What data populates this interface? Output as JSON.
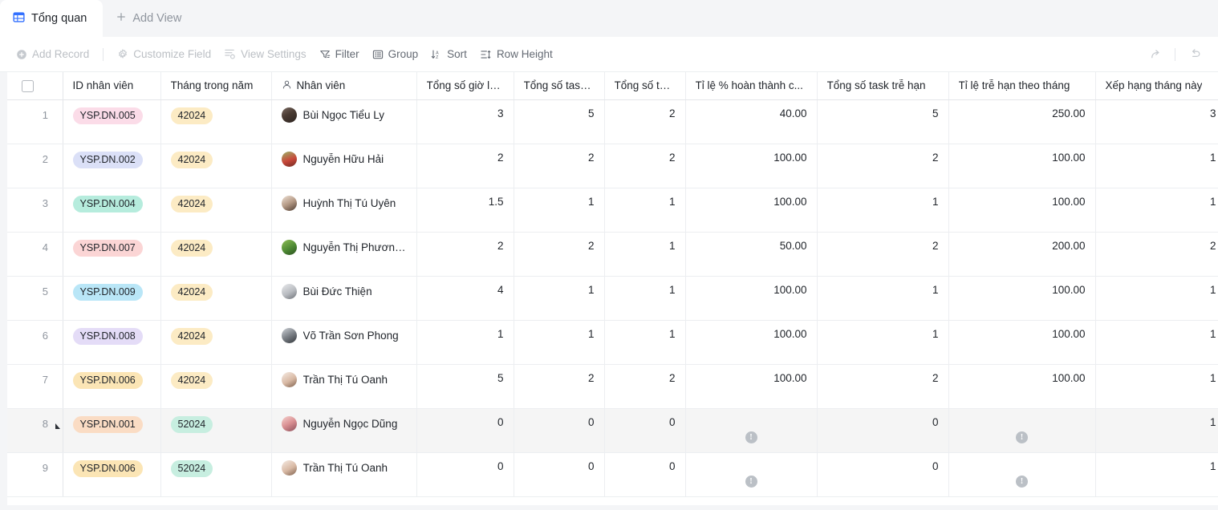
{
  "tabs": [
    {
      "label": "Tổng quan",
      "icon": "grid-icon",
      "active": true
    },
    {
      "label": "Add View",
      "icon": "plus-icon",
      "active": false
    }
  ],
  "toolbar": {
    "add_record": "Add Record",
    "customize_field": "Customize Field",
    "view_settings": "View Settings",
    "filter": "Filter",
    "group": "Group",
    "sort": "Sort",
    "row_height": "Row Height",
    "share_icon": "share-icon",
    "undo_icon": "undo-icon"
  },
  "grid": {
    "columns": [
      {
        "key": "chk",
        "label": "",
        "icon": "checkbox-icon",
        "align": "center"
      },
      {
        "key": "id",
        "label": "ID nhân viên",
        "align": "left"
      },
      {
        "key": "month",
        "label": "Tháng trong năm",
        "align": "left"
      },
      {
        "key": "emp",
        "label": "Nhân viên",
        "icon": "person-icon",
        "align": "left"
      },
      {
        "key": "hours",
        "label": "Tổng số giờ là...",
        "align": "right"
      },
      {
        "key": "t1",
        "label": "Tổng số task ...",
        "align": "right"
      },
      {
        "key": "t2",
        "label": "Tổng số tas...",
        "align": "right"
      },
      {
        "key": "pct",
        "label": "Tỉ lệ % hoàn thành c...",
        "align": "right"
      },
      {
        "key": "late",
        "label": "Tổng số task trễ hạn",
        "align": "right"
      },
      {
        "key": "ratio",
        "label": "Tỉ lệ trễ hạn theo tháng",
        "align": "right"
      },
      {
        "key": "rank",
        "label": "Xếp hạng tháng này",
        "align": "right"
      }
    ],
    "rows": [
      {
        "n": "1",
        "id": "YSP.DN.005",
        "id_color": "#fbdce8",
        "month": "42024",
        "month_color": "#fcebc4",
        "emp": "Bùi Ngọc Tiểu Ly",
        "avatar": "photo-female-dark",
        "hours": "3",
        "t1": "5",
        "t2": "2",
        "pct": "40.00",
        "late": "5",
        "ratio": "250.00",
        "rank": "3",
        "highlight": false,
        "expand": false
      },
      {
        "n": "2",
        "id": "YSP.DN.002",
        "id_color": "#dbe0f7",
        "month": "42024",
        "month_color": "#fcebc4",
        "emp": "Nguyễn Hữu Hải",
        "avatar": "photo-red-outdoor",
        "hours": "2",
        "t1": "2",
        "t2": "2",
        "pct": "100.00",
        "late": "2",
        "ratio": "100.00",
        "rank": "1",
        "highlight": false,
        "expand": false
      },
      {
        "n": "3",
        "id": "YSP.DN.004",
        "id_color": "#b6ecdd",
        "month": "42024",
        "month_color": "#fcebc4",
        "emp": "Huỳnh Thị Tú Uyên",
        "avatar": "photo-female-bob",
        "hours": "1.5",
        "t1": "1",
        "t2": "1",
        "pct": "100.00",
        "late": "1",
        "ratio": "100.00",
        "rank": "1",
        "highlight": false,
        "expand": false
      },
      {
        "n": "4",
        "id": "YSP.DN.007",
        "id_color": "#fbd5d5",
        "month": "42024",
        "month_color": "#fcebc4",
        "emp": "Nguyễn Thị Phương ...",
        "avatar": "photo-green-field",
        "hours": "2",
        "t1": "2",
        "t2": "1",
        "pct": "50.00",
        "late": "2",
        "ratio": "200.00",
        "rank": "2",
        "highlight": false,
        "expand": false
      },
      {
        "n": "5",
        "id": "YSP.DN.009",
        "id_color": "#b9e6f7",
        "month": "42024",
        "month_color": "#fcebc4",
        "emp": "Bùi Đức Thiện",
        "avatar": "photo-male-gray",
        "hours": "4",
        "t1": "1",
        "t2": "1",
        "pct": "100.00",
        "late": "1",
        "ratio": "100.00",
        "rank": "1",
        "highlight": false,
        "expand": false
      },
      {
        "n": "6",
        "id": "YSP.DN.008",
        "id_color": "#e4dcf7",
        "month": "42024",
        "month_color": "#fcebc4",
        "emp": "Võ Trần Sơn Phong",
        "avatar": "photo-male-dark",
        "hours": "1",
        "t1": "1",
        "t2": "1",
        "pct": "100.00",
        "late": "1",
        "ratio": "100.00",
        "rank": "1",
        "highlight": false,
        "expand": false
      },
      {
        "n": "7",
        "id": "YSP.DN.006",
        "id_color": "#fbe5b5",
        "month": "42024",
        "month_color": "#fcebc4",
        "emp": "Trần Thị Tú Oanh",
        "avatar": "photo-female-light",
        "hours": "5",
        "t1": "2",
        "t2": "2",
        "pct": "100.00",
        "late": "2",
        "ratio": "100.00",
        "rank": "1",
        "highlight": false,
        "expand": false
      },
      {
        "n": "8",
        "id": "YSP.DN.001",
        "id_color": "#fadcc4",
        "month": "52024",
        "month_color": "#c7eee0",
        "emp": "Nguyễn Ngọc Dũng",
        "avatar": "photo-pink-floral",
        "hours": "0",
        "t1": "0",
        "t2": "0",
        "pct": "error-icon",
        "late": "0",
        "ratio": "error-icon",
        "rank": "1",
        "highlight": true,
        "expand": true
      },
      {
        "n": "9",
        "id": "YSP.DN.006",
        "id_color": "#fbe5b5",
        "month": "52024",
        "month_color": "#c7eee0",
        "emp": "Trần Thị Tú Oanh",
        "avatar": "photo-female-light",
        "hours": "0",
        "t1": "0",
        "t2": "0",
        "pct": "error-icon",
        "late": "0",
        "ratio": "error-icon",
        "rank": "1",
        "highlight": false,
        "expand": false
      }
    ]
  },
  "colors": {
    "accent": "#3370ff",
    "page_bg": "#f4f5f7",
    "grid_bg": "#ffffff",
    "text": "#1f2329",
    "muted": "#8f959e",
    "disabled": "#bbbfc4",
    "border": "#eceef1",
    "row_highlight": "#f5f5f5",
    "error_badge": "#bbc0c6"
  }
}
